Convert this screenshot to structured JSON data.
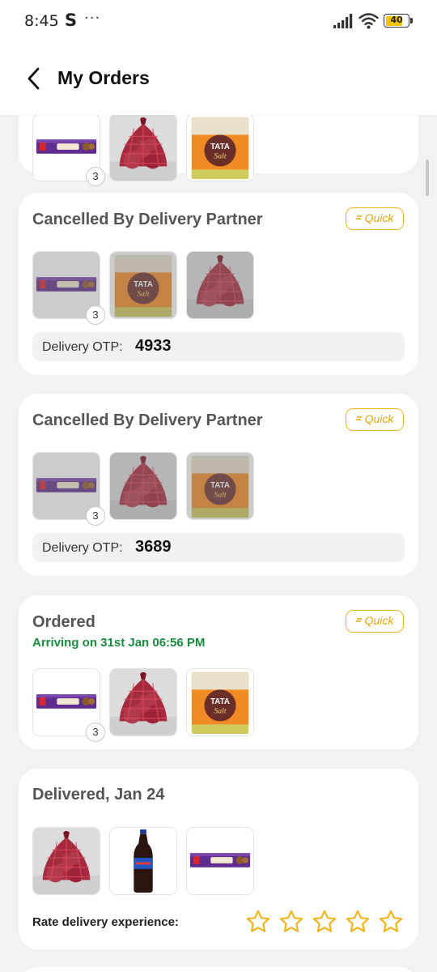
{
  "status_bar": {
    "time": "8:45",
    "app_glyph": "S",
    "more": "···",
    "battery": "40"
  },
  "header": {
    "title": "My Orders",
    "back_icon": "chevron-left-icon"
  },
  "colors": {
    "accent": "#f0b429",
    "arriving": "#1a8a3f",
    "card_bg": "#ffffff",
    "page_bg": "#f2f2f2"
  },
  "quick_label": "Quick",
  "orders": [
    {
      "status": "",
      "items": [
        "chocolate-biscuit-pack",
        "onion-mesh-bag",
        "tata-salt-pack"
      ],
      "first_qty": "3"
    },
    {
      "status": "Cancelled By Delivery Partner",
      "quick": "Quick",
      "items": [
        "chocolate-biscuit-pack",
        "tata-salt-pack",
        "onion-mesh-bag"
      ],
      "first_qty": "3",
      "otp_label": "Delivery OTP:",
      "otp": "4933"
    },
    {
      "status": "Cancelled By Delivery Partner",
      "quick": "Quick",
      "items": [
        "chocolate-biscuit-pack",
        "onion-mesh-bag",
        "tata-salt-pack"
      ],
      "first_qty": "3",
      "otp_label": "Delivery OTP:",
      "otp": "3689"
    },
    {
      "status": "Ordered",
      "quick": "Quick",
      "arrival": "Arriving on 31st Jan 06:56 PM",
      "items": [
        "chocolate-biscuit-pack",
        "onion-mesh-bag",
        "tata-salt-pack"
      ],
      "first_qty": "3"
    },
    {
      "status": "Delivered, Jan 24",
      "items": [
        "onion-mesh-bag",
        "cola-bottle",
        "chocolate-biscuit-pack"
      ],
      "rate_label": "Rate delivery experience:",
      "rating_max": 5,
      "rating_value": 0
    }
  ]
}
